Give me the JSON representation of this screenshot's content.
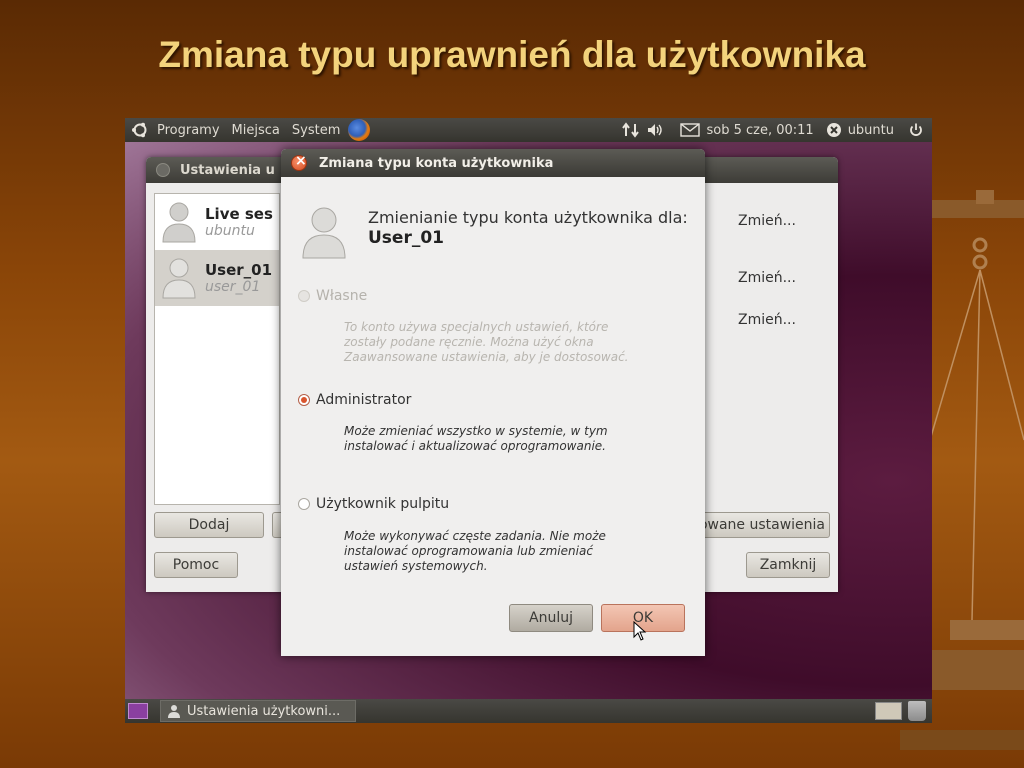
{
  "slide": {
    "title": "Zmiana typu uprawnień dla użytkownika"
  },
  "top_panel": {
    "menus": [
      "Programy",
      "Miejsca",
      "System"
    ],
    "date": "sob  5 cze, 00:11",
    "user": "ubuntu"
  },
  "bottom_panel": {
    "task": "Ustawienia użytkowni..."
  },
  "bg_window": {
    "title": "Ustawienia u",
    "users": [
      {
        "name": "Live ses",
        "login": "ubuntu"
      },
      {
        "name": "User_01",
        "login": "user_01"
      }
    ],
    "change_links": [
      "Zmień...",
      "Zmień...",
      "Zmień..."
    ],
    "add_label": "Dodaj",
    "help_label": "Pomoc",
    "advanced_label": "owane ustawienia",
    "close_label": "Zamknij"
  },
  "dialog": {
    "title": "Zmiana typu konta użytkownika",
    "header": "Zmienianie typu konta użytkownika dla:",
    "username": "User_01",
    "options": [
      {
        "label": "Własne",
        "desc": "To konto używa specjalnych ustawień, które zostały podane ręcznie. Można użyć okna Zaawansowane ustawienia, aby je dostosować."
      },
      {
        "label": "Administrator",
        "desc": "Może zmieniać wszystko w systemie, w tym instalować i aktualizować oprogramowanie."
      },
      {
        "label": "Użytkownik pulpitu",
        "desc": "Może wykonywać częste zadania. Nie może instalować oprogramowania lub zmieniać ustawień systemowych."
      }
    ],
    "cancel_label": "Anuluj",
    "ok_label": "OK"
  }
}
